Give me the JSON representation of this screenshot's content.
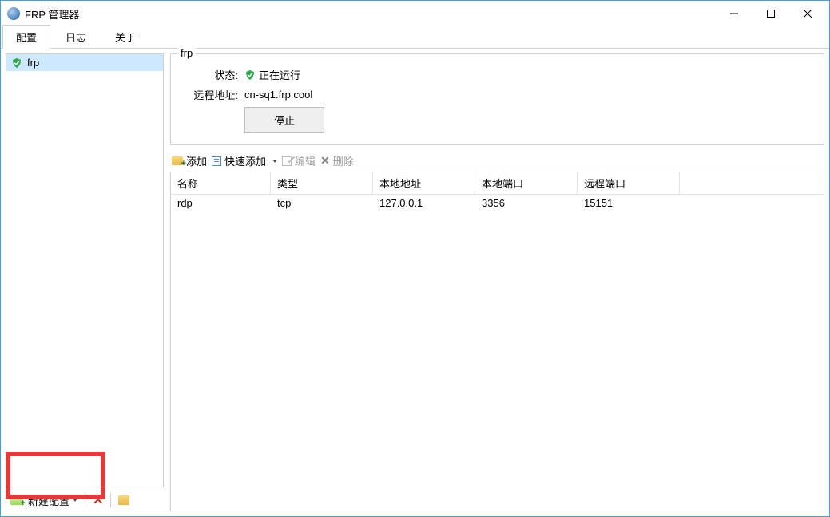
{
  "title": "FRP 管理器",
  "tabs": {
    "config": "配置",
    "log": "日志",
    "about": "关于"
  },
  "sidebar": {
    "items": [
      {
        "label": "frp"
      }
    ],
    "newConfig": "新建配置"
  },
  "details": {
    "name": "frp",
    "statusLabel": "状态:",
    "statusText": "正在运行",
    "remoteLabel": "远程地址:",
    "remoteValue": "cn-sq1.frp.cool",
    "stop": "停止"
  },
  "toolbar": {
    "add": "添加",
    "quickAdd": "快速添加",
    "edit": "编辑",
    "delete": "删除"
  },
  "table": {
    "headers": {
      "name": "名称",
      "type": "类型",
      "localAddr": "本地地址",
      "localPort": "本地端口",
      "remotePort": "远程端口"
    },
    "rows": [
      {
        "name": "rdp",
        "type": "tcp",
        "localAddr": "127.0.0.1",
        "localPort": "3356",
        "remotePort": "15151"
      }
    ]
  }
}
